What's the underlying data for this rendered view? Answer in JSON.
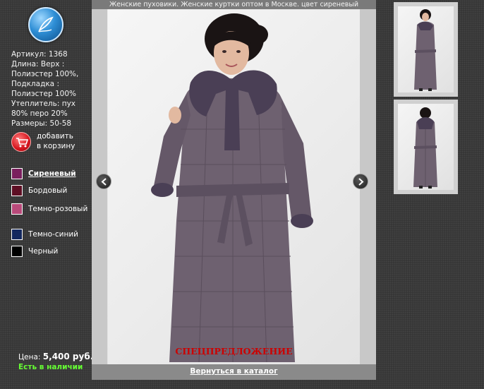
{
  "main": {
    "title": "Женские пуховики. Женские куртки оптом в Москве. цвет сиреневый",
    "offer_label": "СПЕЦПРЕДЛОЖЕНИЕ",
    "back_link": "Вернуться в каталог"
  },
  "specs": [
    "Артикул: 1368",
    "Длина: Верх :",
    "Полиэстер 100%,",
    "Подкладка :",
    "Полиэстер 100%",
    "Утеплитель: пух",
    "80% перо 20%",
    "Размеры: 50-58"
  ],
  "cart": {
    "line1": "добавить",
    "line2": "в корзину"
  },
  "colors": [
    {
      "label": "Сиреневый",
      "swatch": "#7a1f5e",
      "selected": true
    },
    {
      "label": "Бордовый",
      "swatch": "#5e0f24",
      "selected": false
    },
    {
      "label": "Темно-розовый",
      "swatch": "#b84a7a",
      "selected": false
    },
    {
      "label": "Темно-синий",
      "swatch": "#14285e",
      "selected": false
    },
    {
      "label": "Черный",
      "swatch": "#000000",
      "selected": false
    }
  ],
  "price": {
    "label": "Цена:",
    "amount": "5,400 руб."
  },
  "stock": "Есть в наличии",
  "theme": {
    "background": "#343434",
    "coat": "#6e6170",
    "fur": "#4a3f55",
    "offer": "#cc0000",
    "stock": "#66ff33"
  }
}
